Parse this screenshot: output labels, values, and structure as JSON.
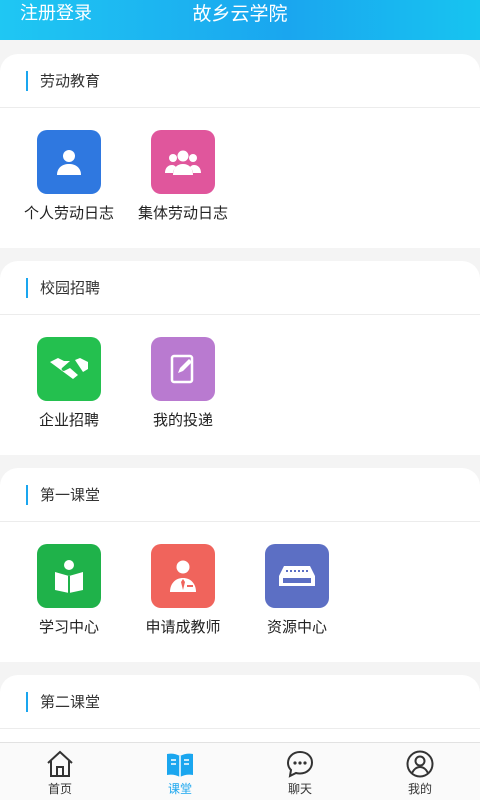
{
  "header": {
    "left_link": "注册登录",
    "title": "故乡云学院",
    "gradient_colors": [
      "#1fc7f3",
      "#1aa6ef"
    ]
  },
  "sections": [
    {
      "title": "劳动教育",
      "items": [
        {
          "label": "个人劳动日志",
          "icon": "person-icon",
          "color": "#2f78e0"
        },
        {
          "label": "集体劳动日志",
          "icon": "group-icon",
          "color": "#e0569c"
        }
      ]
    },
    {
      "title": "校园招聘",
      "items": [
        {
          "label": "企业招聘",
          "icon": "handshake-icon",
          "color": "#24c04f"
        },
        {
          "label": "我的投递",
          "icon": "edit-note-icon",
          "color": "#b97ad0"
        }
      ]
    },
    {
      "title": "第一课堂",
      "items": [
        {
          "label": "学习中心",
          "icon": "reader-book-icon",
          "color": "#1fb24a"
        },
        {
          "label": "申请成教师",
          "icon": "teacher-icon",
          "color": "#f0645c"
        },
        {
          "label": "资源中心",
          "icon": "server-icon",
          "color": "#5c6fc4"
        }
      ]
    },
    {
      "title": "第二课堂",
      "items": []
    }
  ],
  "tabbar": {
    "active_color": "#1aa6ef",
    "items": [
      {
        "label": "首页",
        "icon": "home-icon"
      },
      {
        "label": "课堂",
        "icon": "book-icon",
        "active": true
      },
      {
        "label": "聊天",
        "icon": "chat-icon"
      },
      {
        "label": "我的",
        "icon": "profile-icon"
      }
    ]
  }
}
